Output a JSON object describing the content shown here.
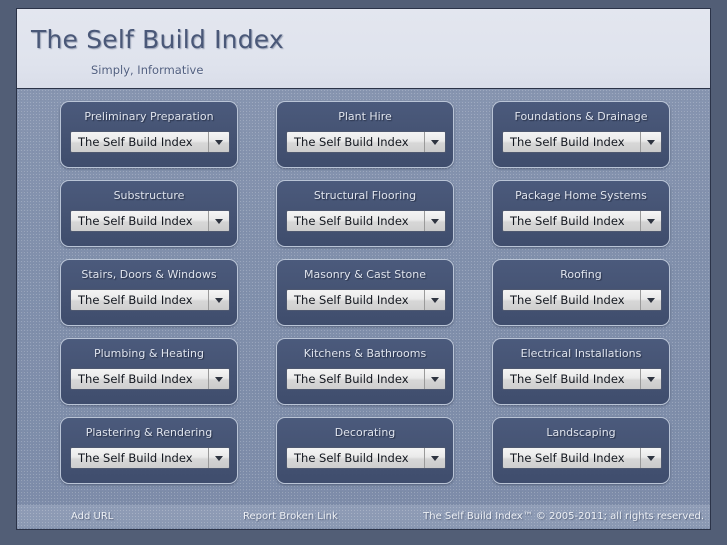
{
  "header": {
    "title": "The Self Build Index",
    "tagline": "Simply, Informative"
  },
  "panels": [
    {
      "title": "Preliminary Preparation",
      "select_value": "The Self Build Index"
    },
    {
      "title": "Plant Hire",
      "select_value": "The Self Build Index"
    },
    {
      "title": "Foundations & Drainage",
      "select_value": "The Self Build Index"
    },
    {
      "title": "Substructure",
      "select_value": "The Self Build Index"
    },
    {
      "title": "Structural Flooring",
      "select_value": "The Self Build Index"
    },
    {
      "title": "Package Home Systems",
      "select_value": "The Self Build Index"
    },
    {
      "title": "Stairs, Doors & Windows",
      "select_value": "The Self Build Index"
    },
    {
      "title": "Masonry & Cast Stone",
      "select_value": "The Self Build Index"
    },
    {
      "title": "Roofing",
      "select_value": "The Self Build Index"
    },
    {
      "title": "Plumbing & Heating",
      "select_value": "The Self Build Index"
    },
    {
      "title": "Kitchens & Bathrooms",
      "select_value": "The Self Build Index"
    },
    {
      "title": "Electrical Installations",
      "select_value": "The Self Build Index"
    },
    {
      "title": "Plastering & Rendering",
      "select_value": "The Self Build Index"
    },
    {
      "title": "Decorating",
      "select_value": "The Self Build Index"
    },
    {
      "title": "Landscaping",
      "select_value": "The Self Build Index"
    }
  ],
  "footer": {
    "add_url": "Add URL",
    "report_broken_link": "Report Broken Link",
    "copyright": "The Self Build Index™ © 2005-2011; all rights reserved."
  },
  "colors": {
    "page_border": "#2b3348",
    "header_bg": "#e0e4ee",
    "header_text": "#4a5878",
    "body_bg": "#8292ad",
    "panel_bg": "#455373",
    "panel_border": "#b9c4d6",
    "panel_text": "#dfe4ee",
    "select_bg": "#eaeaea",
    "select_text": "#13171f",
    "footer_bg": "#8b99b3",
    "footer_text": "#eef1f6"
  }
}
